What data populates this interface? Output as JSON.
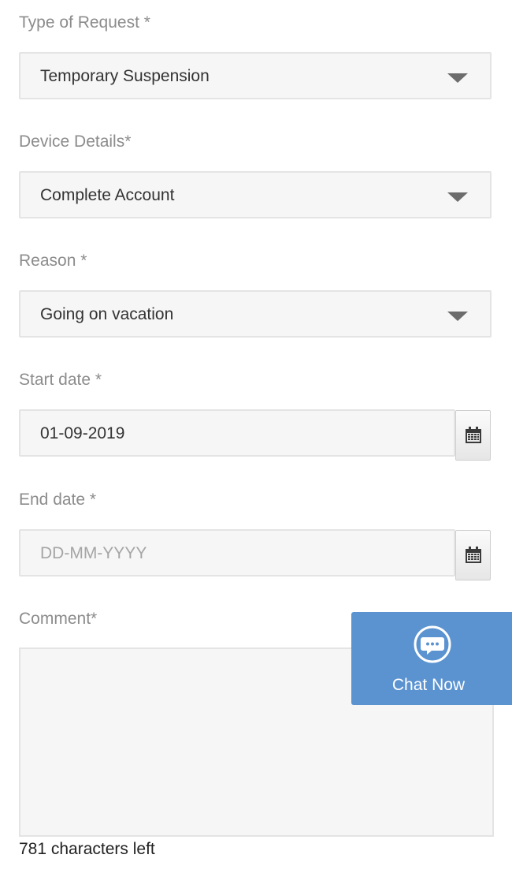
{
  "form": {
    "type_of_request": {
      "label": "Type of Request *",
      "value": "Temporary Suspension"
    },
    "device_details": {
      "label": "Device Details*",
      "value": "Complete Account"
    },
    "reason": {
      "label": "Reason *",
      "value": "Going on vacation"
    },
    "start_date": {
      "label": "Start date *",
      "value": "01-09-2019"
    },
    "end_date": {
      "label": "End date *",
      "placeholder": "DD-MM-YYYY"
    },
    "comment": {
      "label": "Comment*",
      "chars_left": "781 characters left"
    }
  },
  "chat": {
    "label": "Chat Now",
    "icon": "chat-bubble-icon"
  },
  "icons": {
    "dropdown": "chevron-down-icon",
    "calendar": "calendar-icon"
  },
  "colors": {
    "chat_background": "#5b93d0",
    "field_background": "#f6f6f6",
    "label_text": "#8c8c8c"
  }
}
